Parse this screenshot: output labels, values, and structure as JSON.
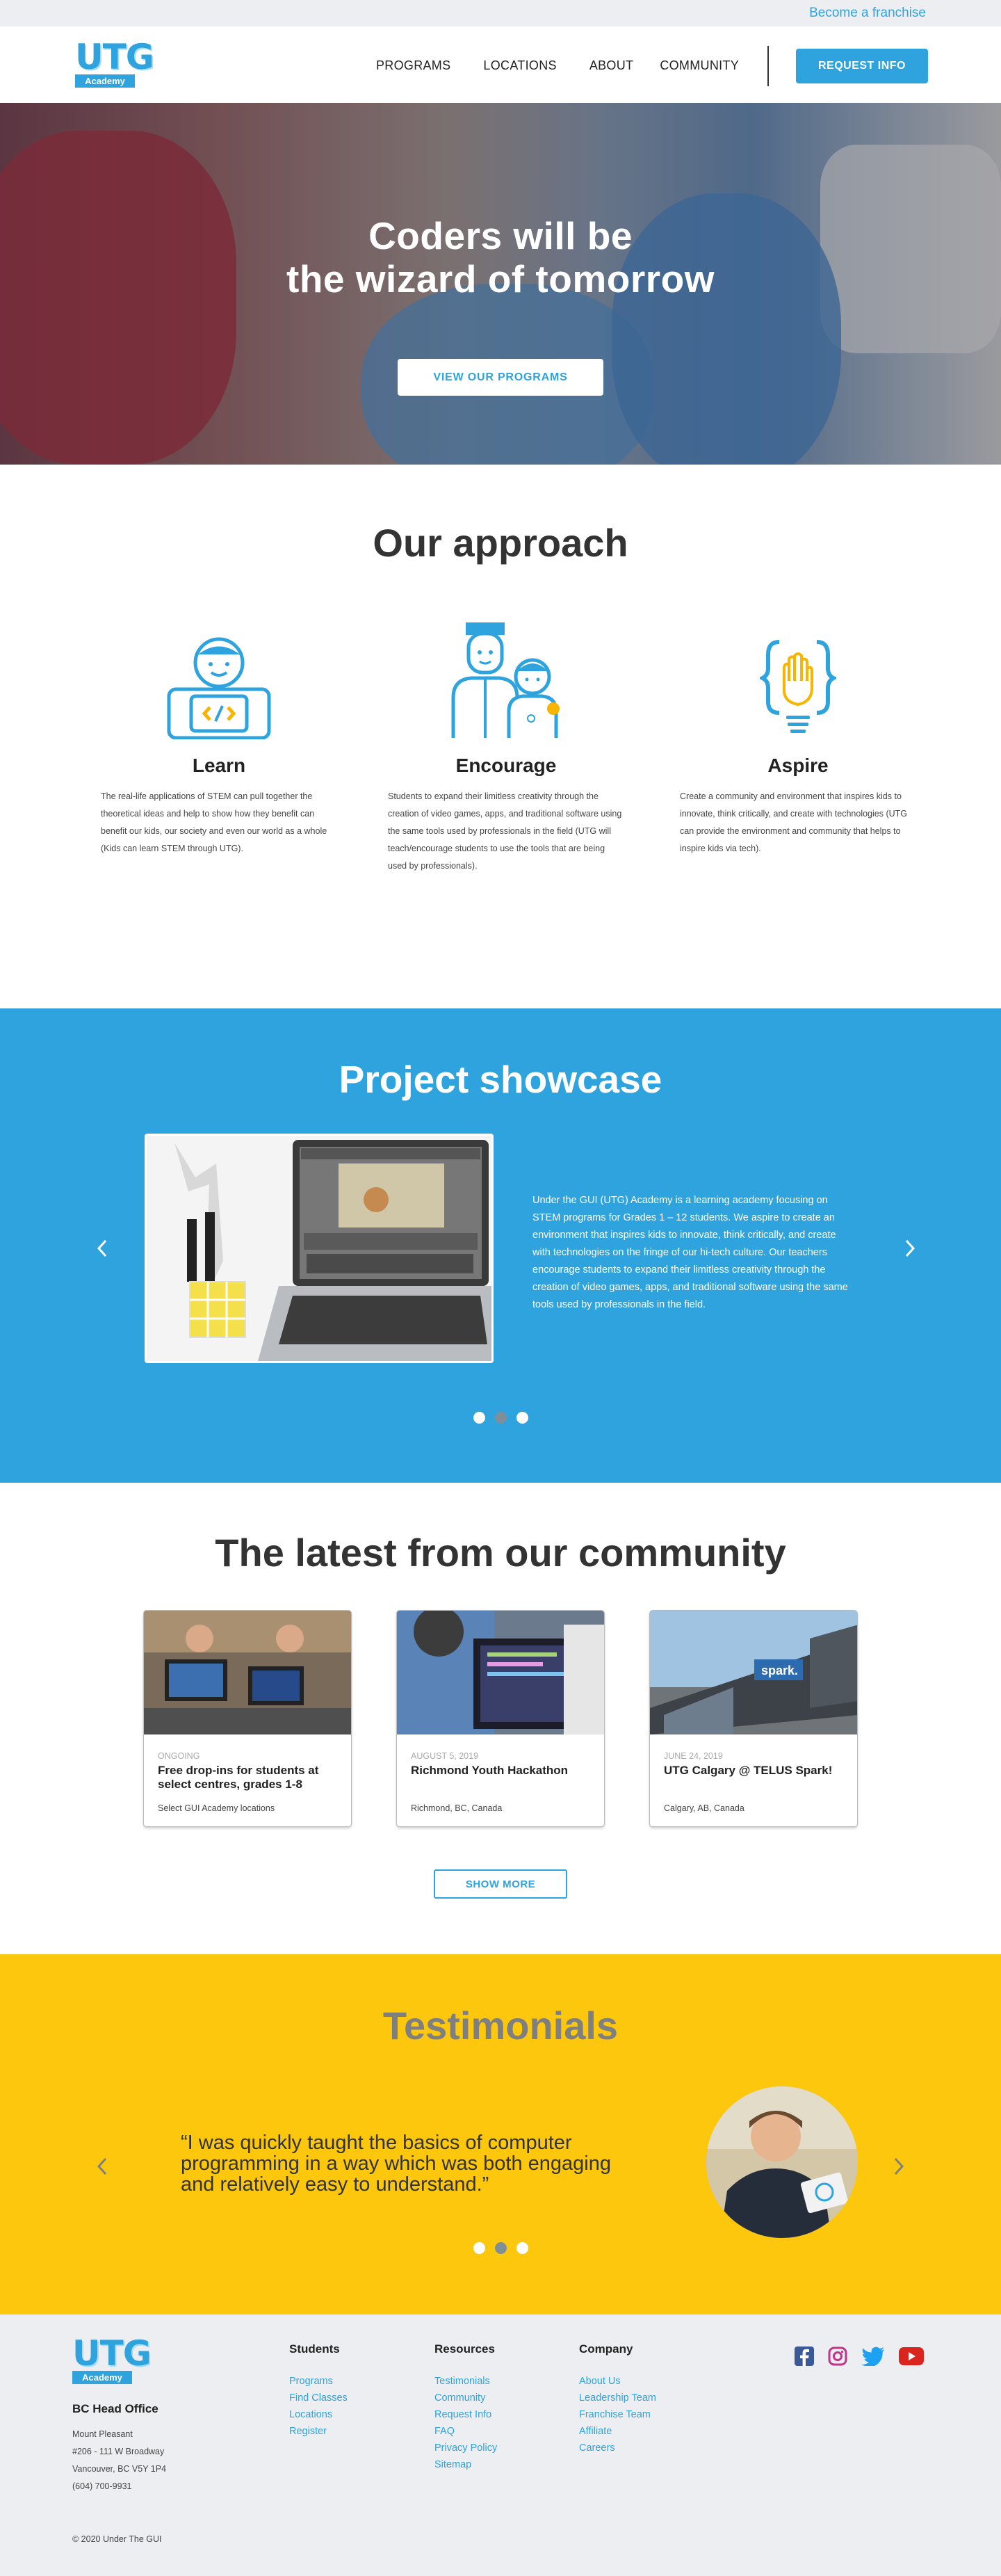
{
  "topbar": {
    "franchise_link": "Become a franchise"
  },
  "header": {
    "logo_text": "UTG",
    "logo_badge": "Academy",
    "nav": [
      "PROGRAMS",
      "LOCATIONS",
      "ABOUT",
      "COMMUNITY"
    ],
    "request_button": "REQUEST INFO"
  },
  "hero": {
    "title_line1": "Coders will be",
    "title_line2": "the wizard of tomorrow",
    "button": "VIEW OUR PROGRAMS"
  },
  "approach": {
    "title": "Our approach",
    "items": [
      {
        "title": "Learn",
        "icon": "kid-code-icon",
        "text": "The real-life applications of STEM can pull together the theoretical ideas and help to show how they benefit can benefit our kids, our society and even our world as a whole (Kids can learn STEM through UTG)."
      },
      {
        "title": "Encourage",
        "icon": "teacher-student-icon",
        "text": "Students to expand their limitless creativity through the creation of video games, apps, and traditional software using the same tools used by professionals in the field (UTG will teach/encourage students to use the tools that are being used by professionals)."
      },
      {
        "title": "Aspire",
        "icon": "bulb-braces-icon",
        "text": "Create a community and environment that inspires kids to innovate, think critically, and create with technologies (UTG can provide the environment and community that helps to inspire kids via tech)."
      }
    ]
  },
  "showcase": {
    "title": "Project showcase",
    "text": "Under the GUI (UTG) Academy is a learning academy focusing on STEM programs for Grades 1 – 12 students. We aspire to create an environment that inspires kids to innovate, think critically, and create with technologies on the fringe of our hi-tech culture. Our teachers encourage students to expand their limitless creativity through the creation of video games, apps, and traditional software using the same tools used by professionals in the field.",
    "slide_count": 3,
    "active_slide": 2
  },
  "community": {
    "title": "The latest from our community",
    "cards": [
      {
        "meta": "ONGOING",
        "title": "Free drop-ins for students at select centres, grades 1-8",
        "location": "Select GUI Academy locations"
      },
      {
        "meta": "AUGUST 5, 2019",
        "title": "Richmond Youth Hackathon",
        "location": "Richmond, BC, Canada"
      },
      {
        "meta": "JUNE 24, 2019",
        "title": "UTG Calgary @ TELUS Spark!",
        "location": "Calgary, AB, Canada"
      }
    ],
    "show_more": "SHOW MORE"
  },
  "testimonials": {
    "title": "Testimonials",
    "quote": "“I was quickly taught the basics of computer programming in a way which was both engaging and relatively easy to understand.”",
    "slide_count": 3,
    "active_slide": 2
  },
  "footer": {
    "office_title": "BC Head Office",
    "office_lines": [
      "Mount Pleasant",
      "#206 - 111 W Broadway",
      "Vancouver, BC V5Y 1P4",
      "(604) 700-9931"
    ],
    "columns": [
      {
        "title": "Students",
        "links": [
          "Programs",
          "Find Classes",
          "Locations",
          "Register"
        ]
      },
      {
        "title": "Resources",
        "links": [
          "Testimonials",
          "Community",
          "Request Info",
          "FAQ",
          "Privacy Policy",
          "Sitemap"
        ]
      },
      {
        "title": "Company",
        "links": [
          "About Us",
          "Leadership Team",
          "Franchise Team",
          "Affiliate",
          "Careers"
        ]
      }
    ],
    "social": [
      "facebook-icon",
      "instagram-icon",
      "twitter-icon",
      "youtube-icon"
    ],
    "copyright": "© 2020 Under The GUI"
  },
  "colors": {
    "brand_blue": "#2ea3dd",
    "yellow": "#fcc70c",
    "light_gray": "#eceef2"
  }
}
